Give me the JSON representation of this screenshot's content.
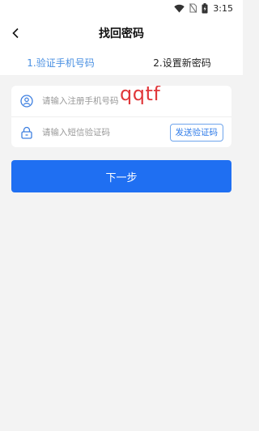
{
  "status_bar": {
    "time": "3:15"
  },
  "header": {
    "title": "找回密码"
  },
  "steps": [
    {
      "label": "1.验证手机号码"
    },
    {
      "label": "2.设置新密码"
    }
  ],
  "form": {
    "phone": {
      "placeholder": "请输入注册手机号码"
    },
    "code": {
      "placeholder": "请输入短信验证码"
    },
    "send_code_label": "发送验证码"
  },
  "watermark_text": "qqtf",
  "next_button_label": "下一步",
  "colors": {
    "accent": "#1f6ff2",
    "step_active": "#4a90e2",
    "watermark": "#e0373a"
  }
}
